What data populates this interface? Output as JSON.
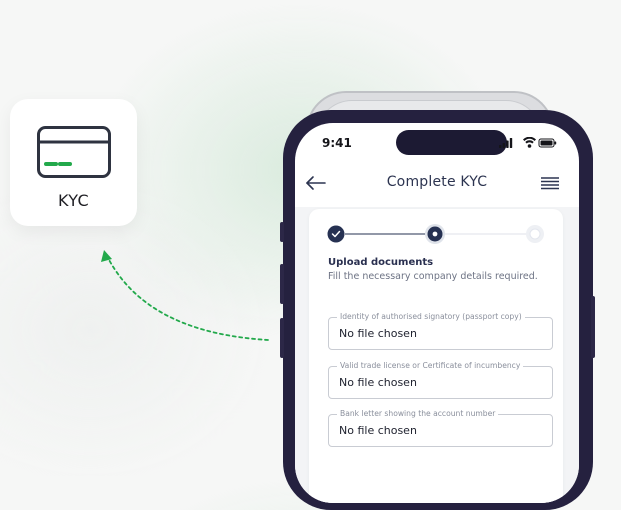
{
  "app_tile": {
    "label": "KYC",
    "icon": "credit-card-icon",
    "accent_color": "#22a94b"
  },
  "status_bar": {
    "time": "9:41",
    "icons": [
      "signal-icon",
      "wifi-icon",
      "battery-icon"
    ]
  },
  "header": {
    "title": "Complete KYC",
    "back_icon": "back-arrow-icon",
    "menu_icon": "menu-icon"
  },
  "stepper": {
    "steps": [
      "completed",
      "current",
      "upcoming"
    ],
    "current_step": 2,
    "total_steps": 3,
    "colors": {
      "active": "#263152",
      "inactive": "#e3e6ee"
    }
  },
  "form": {
    "title": "Upload documents",
    "subtitle": "Fill the necessary company details required.",
    "fields": [
      {
        "label": "Identity of authorised signatory (passport copy)",
        "value": "No file chosen"
      },
      {
        "label": "Valid trade license or Certificate of incumbency",
        "value": "No file chosen"
      },
      {
        "label": "Bank letter  showing the account number",
        "value": "No file chosen"
      }
    ]
  },
  "colors": {
    "phone_frame": "#25213f",
    "arrow": "#22a94b",
    "header_text": "#2c3450"
  }
}
